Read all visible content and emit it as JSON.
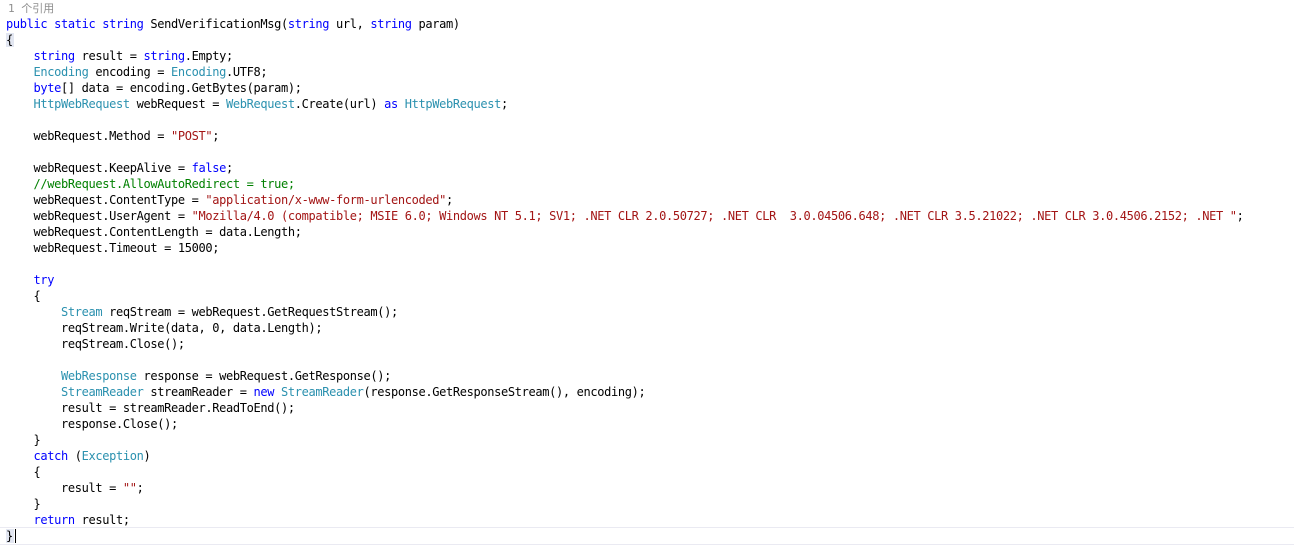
{
  "editor": {
    "codelens": "1 个引用",
    "lines": [
      [
        {
          "t": "public",
          "c": "kw"
        },
        {
          "t": " ",
          "c": "plain"
        },
        {
          "t": "static",
          "c": "kw"
        },
        {
          "t": " ",
          "c": "plain"
        },
        {
          "t": "string",
          "c": "kw"
        },
        {
          "t": " SendVerificationMsg(",
          "c": "plain"
        },
        {
          "t": "string",
          "c": "kw"
        },
        {
          "t": " url, ",
          "c": "plain"
        },
        {
          "t": "string",
          "c": "kw"
        },
        {
          "t": " param)",
          "c": "plain"
        }
      ],
      [
        {
          "t": "{",
          "c": "plain"
        }
      ],
      [
        {
          "t": "    ",
          "c": "plain"
        },
        {
          "t": "string",
          "c": "kw"
        },
        {
          "t": " result = ",
          "c": "plain"
        },
        {
          "t": "string",
          "c": "kw"
        },
        {
          "t": ".Empty;",
          "c": "plain"
        }
      ],
      [
        {
          "t": "    ",
          "c": "plain"
        },
        {
          "t": "Encoding",
          "c": "type"
        },
        {
          "t": " encoding = ",
          "c": "plain"
        },
        {
          "t": "Encoding",
          "c": "type"
        },
        {
          "t": ".UTF8;",
          "c": "plain"
        }
      ],
      [
        {
          "t": "    ",
          "c": "plain"
        },
        {
          "t": "byte",
          "c": "kw"
        },
        {
          "t": "[] data = encoding.GetBytes(param);",
          "c": "plain"
        }
      ],
      [
        {
          "t": "    ",
          "c": "plain"
        },
        {
          "t": "HttpWebRequest",
          "c": "type"
        },
        {
          "t": " webRequest = ",
          "c": "plain"
        },
        {
          "t": "WebRequest",
          "c": "type"
        },
        {
          "t": ".Create(url) ",
          "c": "plain"
        },
        {
          "t": "as",
          "c": "kw"
        },
        {
          "t": " ",
          "c": "plain"
        },
        {
          "t": "HttpWebRequest",
          "c": "type"
        },
        {
          "t": ";",
          "c": "plain"
        }
      ],
      [],
      [
        {
          "t": "    webRequest.Method = ",
          "c": "plain"
        },
        {
          "t": "\"POST\"",
          "c": "str"
        },
        {
          "t": ";",
          "c": "plain"
        }
      ],
      [],
      [
        {
          "t": "    webRequest.KeepAlive = ",
          "c": "plain"
        },
        {
          "t": "false",
          "c": "kw"
        },
        {
          "t": ";",
          "c": "plain"
        }
      ],
      [
        {
          "t": "    ",
          "c": "plain"
        },
        {
          "t": "//webRequest.AllowAutoRedirect = true;",
          "c": "comment"
        }
      ],
      [
        {
          "t": "    webRequest.ContentType = ",
          "c": "plain"
        },
        {
          "t": "\"application/x-www-form-urlencoded\"",
          "c": "str"
        },
        {
          "t": ";",
          "c": "plain"
        }
      ],
      [
        {
          "t": "    webRequest.UserAgent = ",
          "c": "plain"
        },
        {
          "t": "\"Mozilla/4.0 (compatible; MSIE 6.0; Windows NT 5.1; SV1; .NET CLR 2.0.50727; .NET CLR  3.0.04506.648; .NET CLR 3.5.21022; .NET CLR 3.0.4506.2152; .NET \"",
          "c": "str"
        },
        {
          "t": ";",
          "c": "plain"
        }
      ],
      [
        {
          "t": "    webRequest.ContentLength = data.Length;",
          "c": "plain"
        }
      ],
      [
        {
          "t": "    webRequest.Timeout = 15000;",
          "c": "plain"
        }
      ],
      [],
      [
        {
          "t": "    ",
          "c": "plain"
        },
        {
          "t": "try",
          "c": "kw"
        }
      ],
      [
        {
          "t": "    {",
          "c": "plain"
        }
      ],
      [
        {
          "t": "        ",
          "c": "plain"
        },
        {
          "t": "Stream",
          "c": "type"
        },
        {
          "t": " reqStream = webRequest.GetRequestStream();",
          "c": "plain"
        }
      ],
      [
        {
          "t": "        reqStream.Write(data, 0, data.Length);",
          "c": "plain"
        }
      ],
      [
        {
          "t": "        reqStream.Close();",
          "c": "plain"
        }
      ],
      [],
      [
        {
          "t": "        ",
          "c": "plain"
        },
        {
          "t": "WebResponse",
          "c": "type"
        },
        {
          "t": " response = webRequest.GetResponse();",
          "c": "plain"
        }
      ],
      [
        {
          "t": "        ",
          "c": "plain"
        },
        {
          "t": "StreamReader",
          "c": "type"
        },
        {
          "t": " streamReader = ",
          "c": "plain"
        },
        {
          "t": "new",
          "c": "kw"
        },
        {
          "t": " ",
          "c": "plain"
        },
        {
          "t": "StreamReader",
          "c": "type"
        },
        {
          "t": "(response.GetResponseStream(), encoding);",
          "c": "plain"
        }
      ],
      [
        {
          "t": "        result = streamReader.ReadToEnd();",
          "c": "plain"
        }
      ],
      [
        {
          "t": "        response.Close();",
          "c": "plain"
        }
      ],
      [
        {
          "t": "    }",
          "c": "plain"
        }
      ],
      [
        {
          "t": "    ",
          "c": "plain"
        },
        {
          "t": "catch",
          "c": "kw"
        },
        {
          "t": " (",
          "c": "plain"
        },
        {
          "t": "Exception",
          "c": "type"
        },
        {
          "t": ")",
          "c": "plain"
        }
      ],
      [
        {
          "t": "    {",
          "c": "plain"
        }
      ],
      [
        {
          "t": "        result = ",
          "c": "plain"
        },
        {
          "t": "\"\"",
          "c": "str"
        },
        {
          "t": ";",
          "c": "plain"
        }
      ],
      [
        {
          "t": "    }",
          "c": "plain"
        }
      ],
      [
        {
          "t": "    ",
          "c": "plain"
        },
        {
          "t": "return",
          "c": "kw"
        },
        {
          "t": " result;",
          "c": "plain"
        }
      ],
      [
        {
          "t": "}",
          "c": "plain"
        }
      ]
    ],
    "colors": {
      "keyword": "#0000ff",
      "type": "#2b91af",
      "string": "#a31515",
      "comment": "#008000",
      "plain": "#000000",
      "codelens": "#8e8e8e",
      "brace_match": "#e2e6f1"
    }
  }
}
